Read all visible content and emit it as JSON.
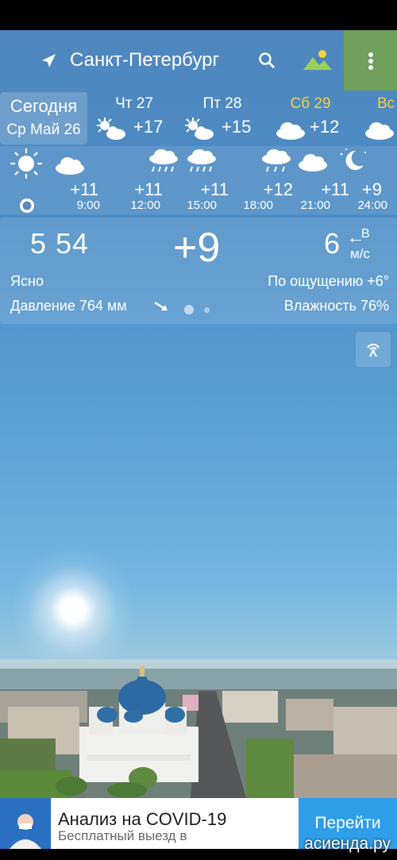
{
  "header": {
    "city": "Санкт-Петербург"
  },
  "daily": {
    "today_title": "Сегодня",
    "today_date": "Ср Май 26",
    "days": [
      {
        "name": "Чт 27",
        "temp": "+17",
        "icon": "sun-cloud-icon"
      },
      {
        "name": "Пт 28",
        "temp": "+15",
        "icon": "sun-cloud-icon"
      },
      {
        "name": "Сб 29",
        "temp": "+12",
        "icon": "cloud-icon"
      },
      {
        "name": "Вс",
        "temp": "",
        "icon": "cloud-icon"
      }
    ]
  },
  "hourly": [
    {
      "time": "9:00",
      "temp": "+11",
      "icon": "sun-icon"
    },
    {
      "time": "12:00",
      "temp": "+11",
      "icon": "cloud-icon"
    },
    {
      "time": "15:00",
      "temp": "+11",
      "icon": "rain-icon"
    },
    {
      "time": "18:00",
      "temp": "+12",
      "icon": "rain-icon"
    },
    {
      "time": "21:00",
      "temp": "+11",
      "icon": "rain-cloud-icon"
    },
    {
      "time": "24:00",
      "temp": "+9",
      "icon": "moon-cloud-icon"
    }
  ],
  "current": {
    "sunrise": "5 54",
    "temp": "+9",
    "wind_speed": "6",
    "wind_dir": "В",
    "wind_unit": "м/с",
    "condition": "Ясно",
    "feels_like": "По ощущению +6°",
    "pressure": "Давление 764 мм",
    "humidity": "Влажность 76%"
  },
  "ad": {
    "title": "Анализ на COVID-19",
    "subtitle": "Бесплатный выезд в",
    "button": "Перейти"
  },
  "watermark": "асиенда.ру"
}
